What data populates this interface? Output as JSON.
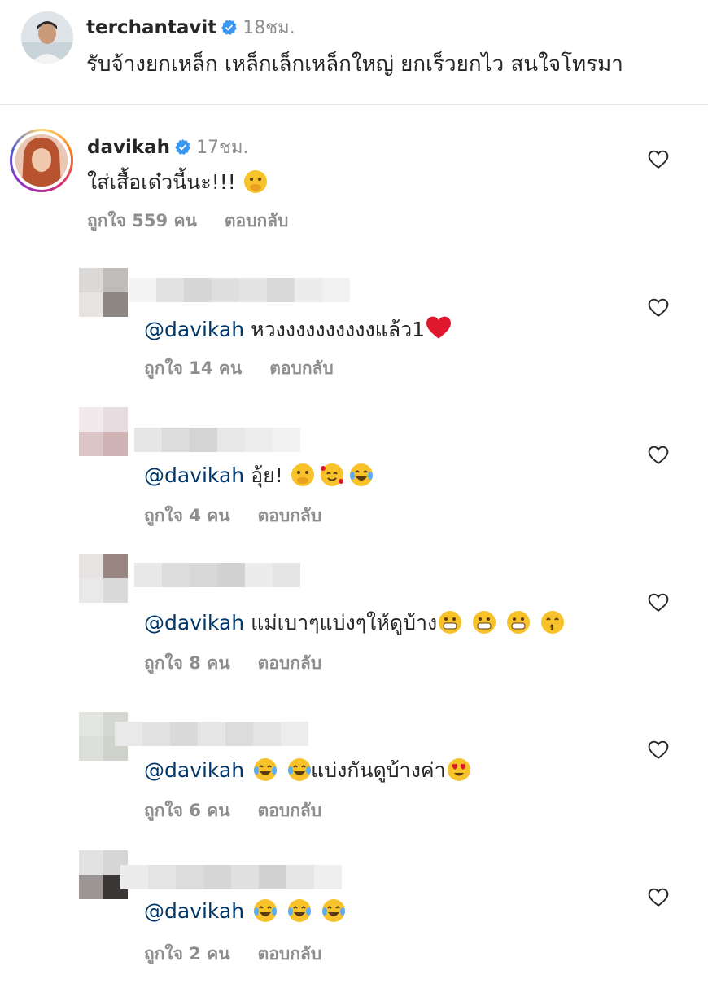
{
  "caption": {
    "username": "terchantavit",
    "time": "18ชม.",
    "text": "รับจ้างยกเหล็ก เหล็กเล็กเหล็กใหญ่  ยกเร็วยกไว สนใจโทรมา"
  },
  "top_comment": {
    "username": "davikah",
    "time": "17ชม.",
    "text": "ใส่เสื้อเด๋วนี้นะ!!!",
    "likes": "ถูกใจ 559 คน",
    "reply": "ตอบกลับ"
  },
  "replies": [
    {
      "mention": "@davikah",
      "text": " หวงงงงงงงงงงแล้ว1",
      "likes": "ถูกใจ 14 คน",
      "reply": "ตอบกลับ"
    },
    {
      "mention": "@davikah",
      "text": " อุ้ย! ",
      "likes": "ถูกใจ 4 คน",
      "reply": "ตอบกลับ"
    },
    {
      "mention": "@davikah",
      "text": " แม่เบาๆแบ่งๆให้ดูบ้าง",
      "likes": "ถูกใจ 8 คน",
      "reply": "ตอบกลับ"
    },
    {
      "mention": "@davikah",
      "text": "แบ่งกันดูบ้างค่า",
      "likes": "ถูกใจ 6 คน",
      "reply": "ตอบกลับ"
    },
    {
      "mention": "@davikah",
      "text": "",
      "likes": "ถูกใจ 2 คน",
      "reply": "ตอบกลับ"
    }
  ],
  "icons": {
    "verified": "verified-badge-icon",
    "like": "heart-outline-icon"
  },
  "colors": {
    "verified": "#3897f0",
    "mention": "#00376b",
    "meta": "#8e8e8e"
  }
}
